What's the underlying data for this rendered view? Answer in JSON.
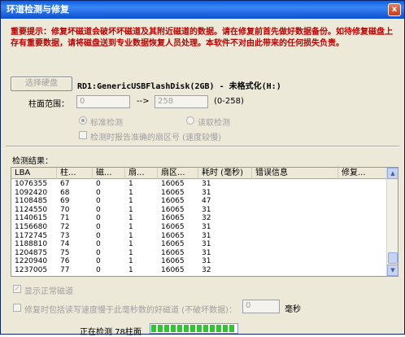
{
  "window": {
    "title": "环道检测与修复",
    "close_symbol": "x"
  },
  "warning_text": "重要提示：修复坏磁道会破坏坏磁道及其附近磁道的数据。请在修复前首先做好数据备份。如待修复磁盘上存有重要数据，请将磁盘送到专业数据恢复人员处理。本软件不对由此带来的任何损失负责。",
  "disk": {
    "select_button": "选择硬盘",
    "name": "RD1:GenericUSBFlashDisk(2GB) - 未格式化(H:)"
  },
  "cylinder": {
    "label": "柱面范围：",
    "from": "0",
    "arrow": "-->",
    "to": "258",
    "range": "(0-258)"
  },
  "options": {
    "standard_check": "标准检测",
    "read_check": "读取检测",
    "report_sectors": "检测时报告准确的扇区号 (速度较慢)"
  },
  "results_label": "检测结果：",
  "table": {
    "columns": [
      "LBA",
      "柱...",
      "磁...",
      "扇...",
      "扇区...",
      "耗时 (毫秒)",
      "错误信息",
      "修复..."
    ],
    "rows": [
      [
        "1076355",
        "67",
        "0",
        "1",
        "16065",
        "31",
        "",
        ""
      ],
      [
        "1092420",
        "68",
        "0",
        "1",
        "16065",
        "31",
        "",
        ""
      ],
      [
        "1108485",
        "69",
        "0",
        "1",
        "16065",
        "47",
        "",
        ""
      ],
      [
        "1124550",
        "70",
        "0",
        "1",
        "16065",
        "31",
        "",
        ""
      ],
      [
        "1140615",
        "71",
        "0",
        "1",
        "16065",
        "32",
        "",
        ""
      ],
      [
        "1156680",
        "72",
        "0",
        "1",
        "16065",
        "31",
        "",
        ""
      ],
      [
        "1172745",
        "73",
        "0",
        "1",
        "16065",
        "31",
        "",
        ""
      ],
      [
        "1188810",
        "74",
        "0",
        "1",
        "16065",
        "31",
        "",
        ""
      ],
      [
        "1204875",
        "75",
        "0",
        "1",
        "16065",
        "31",
        "",
        ""
      ],
      [
        "1220940",
        "76",
        "0",
        "1",
        "16065",
        "31",
        "",
        ""
      ],
      [
        "1237005",
        "77",
        "0",
        "1",
        "16065",
        "32",
        "",
        ""
      ]
    ]
  },
  "show_normal": {
    "checked_symbol": "✓",
    "label": "显示正常磁道"
  },
  "repair_option": {
    "label": "修复时包括读写速度慢于此毫秒数的好磁道 (不破坏数据)：",
    "value": "0",
    "unit": "毫秒"
  },
  "status": {
    "text": "正在检测 78柱面",
    "progress": 0.98
  }
}
